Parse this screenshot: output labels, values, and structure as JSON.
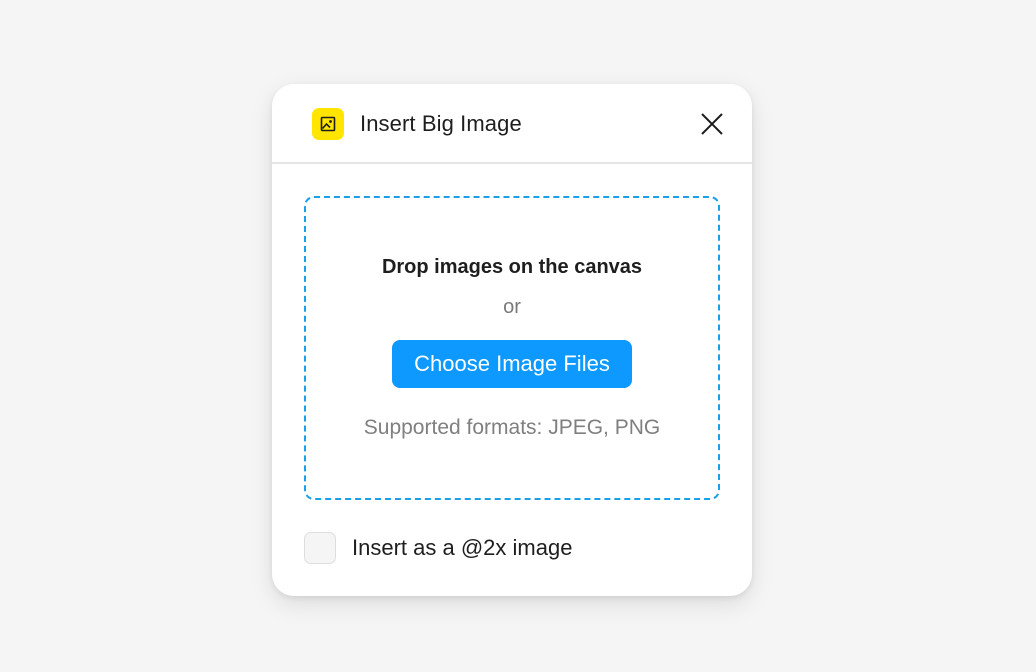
{
  "dialog": {
    "title": "Insert Big Image",
    "plugin_icon": "image-plugin-icon",
    "close_icon": "close-icon"
  },
  "drop_zone": {
    "title": "Drop images on the canvas",
    "or_text": "or",
    "button_label": "Choose Image Files",
    "formats_text": "Supported formats: JPEG, PNG"
  },
  "option": {
    "checkbox_label": "Insert as a @2x image",
    "checked": false
  },
  "colors": {
    "accent": "#0d99ff",
    "plugin_icon_bg": "#ffe500",
    "dashed_border": "#1aa0e8"
  }
}
